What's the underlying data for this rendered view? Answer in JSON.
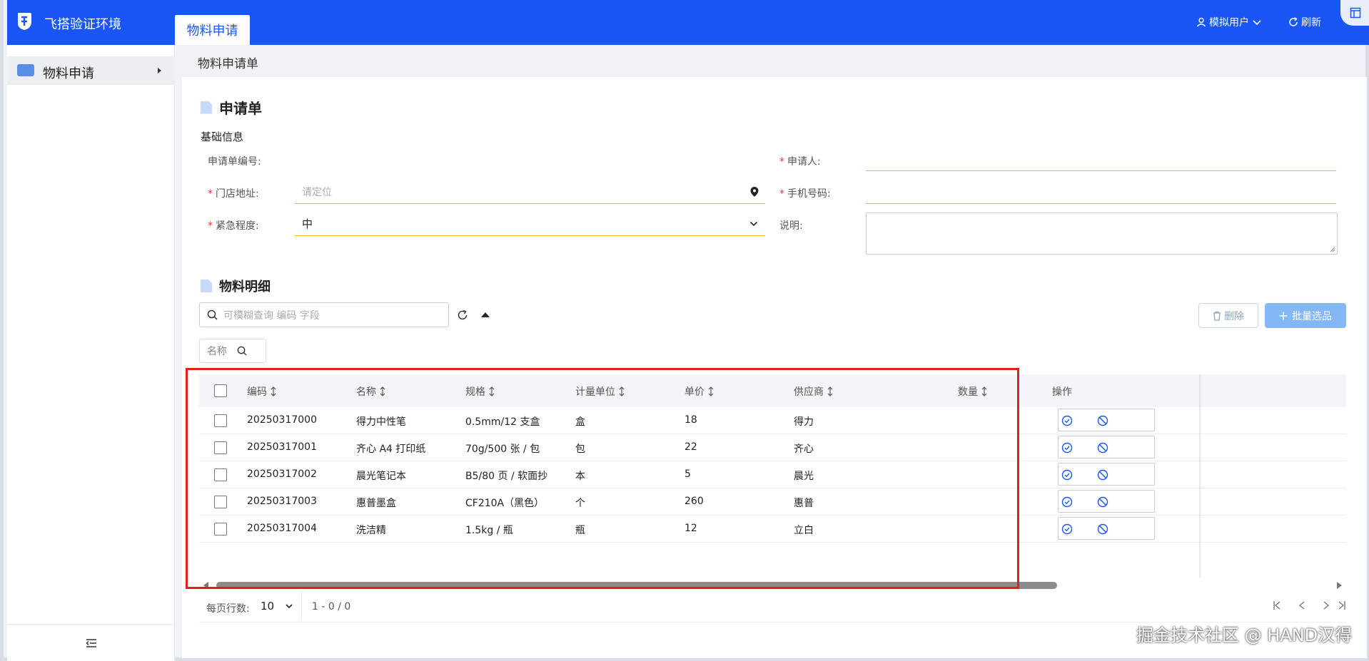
{
  "app": {
    "title": "飞搭验证环境",
    "active_tab": "物料申请"
  },
  "header": {
    "user_label": "模拟用户",
    "refresh_label": "刷新"
  },
  "sidebar": {
    "items": [
      {
        "label": "物料申请"
      }
    ]
  },
  "breadcrumb": "物料申请单",
  "form": {
    "section_title": "申请单",
    "subsection_title": "基础信息",
    "order_no": {
      "label": "申请单编号:",
      "value": ""
    },
    "applicant": {
      "label": "申请人:",
      "value": ""
    },
    "store_address": {
      "label": "门店地址:",
      "placeholder": "请定位"
    },
    "phone": {
      "label": "手机号码:",
      "value": ""
    },
    "urgency": {
      "label": "紧急程度:",
      "value": "中"
    },
    "remark": {
      "label": "说明:",
      "value": ""
    }
  },
  "materials": {
    "section_title": "物料明细",
    "search_placeholder": "可模糊查询 编码 字段",
    "filter_chip": "名称",
    "delete_label": "删除",
    "batch_label": "批量选品",
    "columns": [
      "编码",
      "名称",
      "规格",
      "计量单位",
      "单价",
      "供应商",
      "数量",
      "操作"
    ],
    "rows": [
      {
        "code": "20250317000",
        "name": "得力中性笔",
        "spec": "0.5mm/12 支盒",
        "unit": "盒",
        "price": "18",
        "supplier": "得力",
        "qty": ""
      },
      {
        "code": "20250317001",
        "name": "齐心 A4 打印纸",
        "spec": "70g/500 张 / 包",
        "unit": "包",
        "price": "22",
        "supplier": "齐心",
        "qty": ""
      },
      {
        "code": "20250317002",
        "name": "晨光笔记本",
        "spec": "B5/80 页 / 软面抄",
        "unit": "本",
        "price": "5",
        "supplier": "晨光",
        "qty": ""
      },
      {
        "code": "20250317003",
        "name": "惠普墨盒",
        "spec": "CF210A（黑色）",
        "unit": "个",
        "price": "260",
        "supplier": "惠普",
        "qty": ""
      },
      {
        "code": "20250317004",
        "name": "洗洁精",
        "spec": "1.5kg / 瓶",
        "unit": "瓶",
        "price": "12",
        "supplier": "立白",
        "qty": ""
      }
    ]
  },
  "pagination": {
    "rows_per_page_label": "每页行数:",
    "rows_per_page": "10",
    "range": "1 - 0 / 0"
  },
  "watermark": "掘金技术社区 @ HAND汉得",
  "colors": {
    "brand": "#1a56f5",
    "required": "#e23b3b",
    "field_underline": "#f2b51b",
    "highlight": "#e02020"
  }
}
